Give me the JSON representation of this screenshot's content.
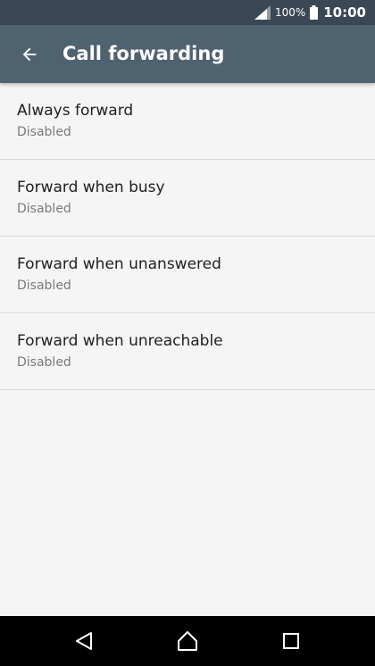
{
  "status_bar": {
    "battery_percent": "100%",
    "time": "10:00",
    "icons": [
      "signal-icon",
      "battery-icon"
    ]
  },
  "app_bar": {
    "back_icon": "arrow-left-icon",
    "title": "Call forwarding"
  },
  "settings": [
    {
      "title": "Always forward",
      "status": "Disabled"
    },
    {
      "title": "Forward when busy",
      "status": "Disabled"
    },
    {
      "title": "Forward when unanswered",
      "status": "Disabled"
    },
    {
      "title": "Forward when unreachable",
      "status": "Disabled"
    }
  ],
  "nav_bar": {
    "icons": [
      "back-triangle-icon",
      "home-icon",
      "recents-icon"
    ]
  },
  "colors": {
    "status_bar": "#3a4754",
    "app_bar": "#4f6270",
    "background": "#f5f5f5",
    "nav_bar": "#000000"
  }
}
